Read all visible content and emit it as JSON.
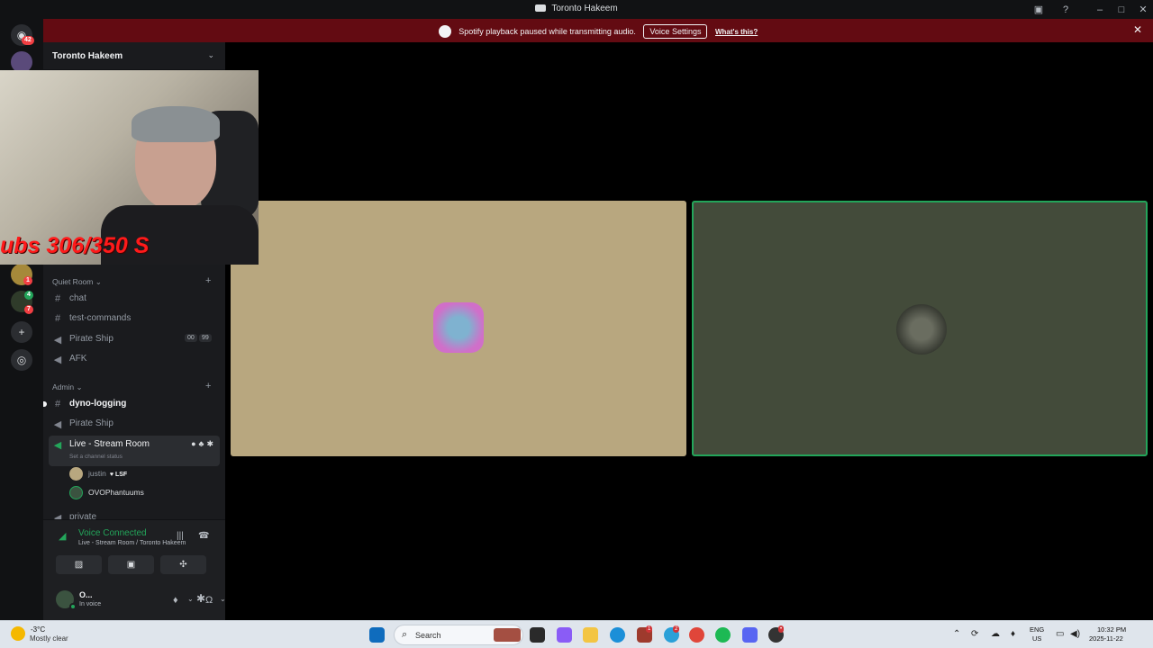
{
  "window": {
    "title": "Toronto Hakeem"
  },
  "banner": {
    "message": "Spotify playback paused while transmitting audio.",
    "button": "Voice Settings",
    "link": "What's this?"
  },
  "rail": {
    "home_badge": "42",
    "badges": [
      "1",
      "4",
      "7"
    ]
  },
  "server": {
    "name": "Toronto Hakeem"
  },
  "categories": {
    "quiet_room": "Quiet Room",
    "admin": "Admin"
  },
  "channels": {
    "chat": "chat",
    "test_commands": "test-commands",
    "pirate_ship_1": "Pirate Ship",
    "pirate_ship_1_counts": [
      "00",
      "99"
    ],
    "afk": "AFK",
    "dyno_logging": "dyno-logging",
    "pirate_ship_2": "Pirate Ship",
    "live_stream": "Live - Stream Room",
    "live_status": "Set a channel status",
    "private": "private"
  },
  "voice_users": [
    {
      "name": "justin",
      "tag": "LSF"
    },
    {
      "name": "OVOPhantuums",
      "tag": ""
    }
  ],
  "voice_panel": {
    "title": "Voice Connected",
    "subtitle": "Live - Stream Room / Toronto Hakeem"
  },
  "user": {
    "name": "O...",
    "status": "In voice"
  },
  "overlay": {
    "text": "ubs 306/350 S"
  },
  "taskbar": {
    "weather_temp": "-3°C",
    "weather_desc": "Mostly clear",
    "search": "Search",
    "lang1": "ENG",
    "lang2": "US",
    "time": "10:32 PM",
    "date": "2025-11-22"
  },
  "colors": {
    "accent_green": "#23a55a",
    "banner_red": "#630b12",
    "tile_left": "#b8a77f",
    "tile_right": "#434b3a"
  }
}
